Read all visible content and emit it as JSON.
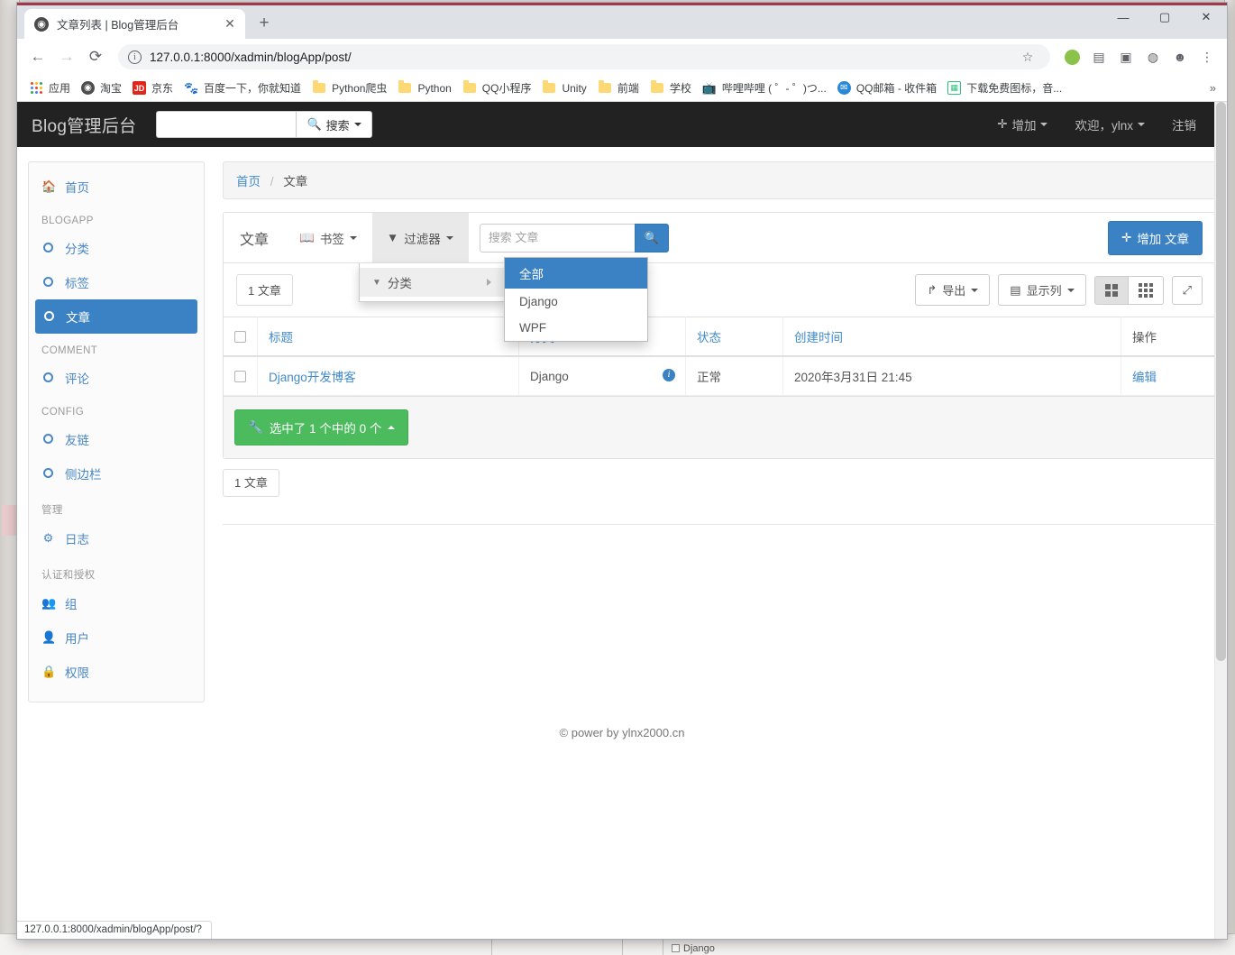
{
  "browser": {
    "tab": {
      "title": "文章列表 | Blog管理后台",
      "favicon": "globe-icon",
      "close": "✕"
    },
    "new_tab": "+",
    "window_controls": {
      "minimize": "—",
      "maximize": "▢",
      "close": "✕"
    },
    "nav": {
      "back": "←",
      "forward": "→",
      "reload": "⟳"
    },
    "omnibox": {
      "info": "i",
      "url": "127.0.0.1:8000/xadmin/blogApp/post/",
      "star": "☆"
    },
    "toolbar_icons": [
      "puzzle-icon",
      "cast-icon",
      "image-icon",
      "profile-circle-icon",
      "menu-kebab-icon"
    ],
    "bookmarks": [
      {
        "label": "应用",
        "icon": "apps-grid-icon"
      },
      {
        "label": "淘宝",
        "icon": "taobao-icon"
      },
      {
        "label": "京东",
        "icon": "jd-icon"
      },
      {
        "label": "百度一下，你就知道",
        "icon": "baidu-icon"
      },
      {
        "label": "Python爬虫",
        "icon": "folder-icon"
      },
      {
        "label": "Python",
        "icon": "folder-icon"
      },
      {
        "label": "QQ小程序",
        "icon": "folder-icon"
      },
      {
        "label": "Unity",
        "icon": "folder-icon"
      },
      {
        "label": "前端",
        "icon": "folder-icon"
      },
      {
        "label": "学校",
        "icon": "folder-icon"
      },
      {
        "label": "哔哩哔哩 ( ゜- ゜)つ...",
        "icon": "bilibili-icon"
      },
      {
        "label": "QQ邮箱 - 收件箱",
        "icon": "qqmail-icon"
      },
      {
        "label": "下载免费图标，音...",
        "icon": "iconfont-icon"
      }
    ],
    "bookmark_overflow": "»",
    "status_bubble": "127.0.0.1:8000/xadmin/blogApp/post/?"
  },
  "navbar": {
    "brand": "Blog管理后台",
    "search_value": "",
    "search_button": "搜索",
    "add_label": "增加",
    "welcome": "欢迎，ylnx",
    "logout": "注销"
  },
  "sidebar": [
    {
      "type": "item",
      "label": "首页",
      "icon": "home-icon",
      "active": false
    },
    {
      "type": "head",
      "label": "BLOGAPP"
    },
    {
      "type": "item",
      "label": "分类",
      "icon": "circle-icon",
      "active": false
    },
    {
      "type": "item",
      "label": "标签",
      "icon": "circle-icon",
      "active": false
    },
    {
      "type": "item",
      "label": "文章",
      "icon": "circle-icon",
      "active": true
    },
    {
      "type": "head",
      "label": "COMMENT"
    },
    {
      "type": "item",
      "label": "评论",
      "icon": "circle-icon",
      "active": false
    },
    {
      "type": "head",
      "label": "CONFIG"
    },
    {
      "type": "item",
      "label": "友链",
      "icon": "circle-icon",
      "active": false
    },
    {
      "type": "item",
      "label": "侧边栏",
      "icon": "circle-icon",
      "active": false
    },
    {
      "type": "head",
      "label": "管理"
    },
    {
      "type": "item",
      "label": "日志",
      "icon": "gear-icon",
      "active": false
    },
    {
      "type": "head",
      "label": "认证和授权"
    },
    {
      "type": "item",
      "label": "组",
      "icon": "users-icon",
      "active": false
    },
    {
      "type": "item",
      "label": "用户",
      "icon": "user-icon",
      "active": false
    },
    {
      "type": "item",
      "label": "权限",
      "icon": "lock-icon",
      "active": false
    }
  ],
  "breadcrumb": {
    "home": "首页",
    "sep": "/",
    "current": "文章"
  },
  "toolbar": {
    "title": "文章",
    "bookmark_label": "书签",
    "filter_label": "过滤器",
    "search_placeholder": "搜索 文章",
    "search_value": "",
    "add_label": "增加 文章"
  },
  "filter_menu": {
    "item_label": "分类",
    "options": [
      {
        "label": "全部",
        "selected": true
      },
      {
        "label": "Django",
        "selected": false
      },
      {
        "label": "WPF",
        "selected": false
      }
    ]
  },
  "counts": {
    "top": "1 文章",
    "bottom": "1 文章"
  },
  "view_tools": {
    "export": "导出",
    "columns": "显示列",
    "grid_view": "grid-4-icon",
    "list_view": "grid-9-icon",
    "fullscreen": "expand-arrows-icon"
  },
  "table": {
    "columns": [
      "标题",
      "分类",
      "状态",
      "创建时间",
      "操作"
    ],
    "rows": [
      {
        "title": "Django开发博客",
        "category": "Django",
        "state": "正常",
        "created": "2020年3月31日 21:45",
        "action": "编辑"
      }
    ]
  },
  "action_bar": {
    "label": "选中了 1 个中的 0 个",
    "icon": "wrench-icon"
  },
  "footer": {
    "text": "© power by ylnx2000.cn"
  },
  "background": {
    "cell_label": "Django"
  }
}
